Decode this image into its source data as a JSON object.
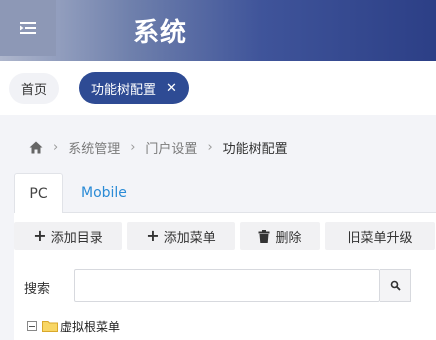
{
  "header": {
    "title": "系统",
    "menu_icon": "menu-collapse-icon"
  },
  "tabs_bar": {
    "home_label": "首页",
    "active_label": "功能树配置",
    "close_glyph": "✕"
  },
  "breadcrumb": {
    "home_icon": "home-icon",
    "items": [
      "系统管理",
      "门户设置",
      "功能树配置"
    ],
    "separator": "›"
  },
  "page_tabs": [
    {
      "label": "PC",
      "active": true
    },
    {
      "label": "Mobile",
      "active": false
    }
  ],
  "toolbar": {
    "add_dir_label": "添加目录",
    "add_menu_label": "添加菜单",
    "delete_label": "删除",
    "upgrade_label": "旧菜单升级"
  },
  "search": {
    "label": "搜索",
    "value": "",
    "placeholder": ""
  },
  "tree": {
    "root_label": "虚拟根菜单",
    "expanded": true
  },
  "colors": {
    "header_dark": "#2c3f86",
    "active_tab": "#2e4b94",
    "link": "#2a8bd6"
  }
}
